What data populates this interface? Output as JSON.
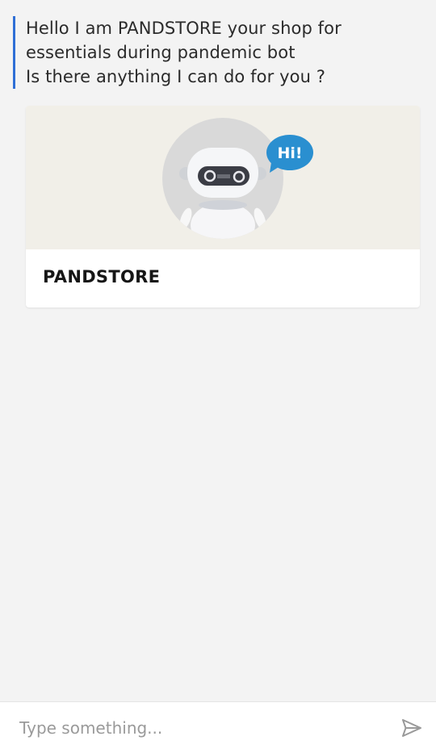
{
  "chat": {
    "bot_message_lines": [
      "Hello I am PANDSTORE your shop for",
      "essentials during pandemic bot",
      "Is there anything I can do for you ?"
    ],
    "card": {
      "image_icon": "robot-hi-illustration",
      "speech_bubble_text": "Hi!",
      "title": "PANDSTORE"
    }
  },
  "composer": {
    "placeholder": "Type something...",
    "send_icon": "send-icon"
  },
  "colors": {
    "accent": "#2f6fd6",
    "bubble": "#2a8fd0",
    "background": "#f3f3f3"
  }
}
